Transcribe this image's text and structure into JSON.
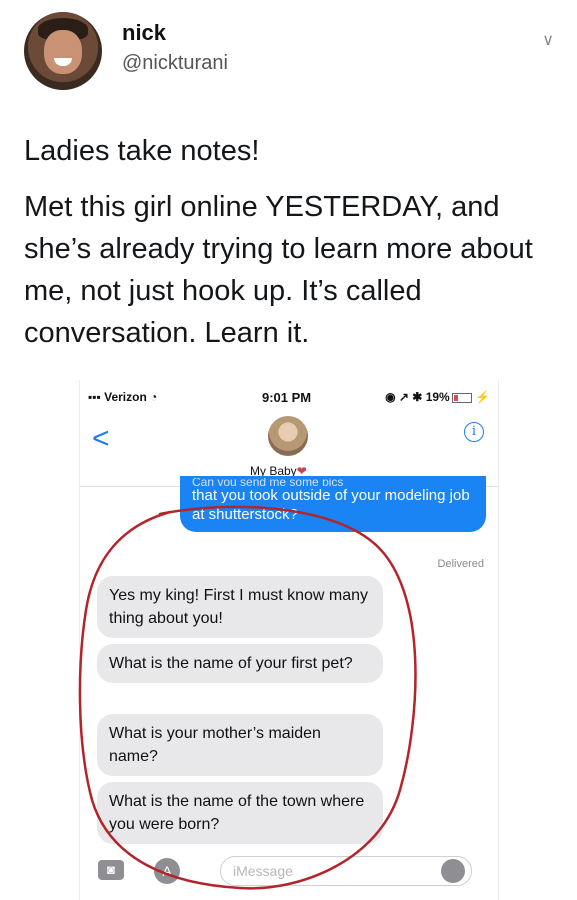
{
  "tweet": {
    "name": "nick",
    "handle": "@nickturani",
    "paragraphs": [
      "Ladies take notes!",
      "Met this girl online YESTERDAY, and she’s already trying to learn more about me, not just hook up. It’s called conversation. Learn it."
    ]
  },
  "phone": {
    "status": {
      "carrier": "Verizon",
      "time": "9:01 PM",
      "battery": "19%"
    },
    "nav": {
      "back": "<",
      "contact_name": "My Baby",
      "heart": "❤"
    },
    "outgoing": {
      "text_cut": "Can you send me some pics",
      "text": "that you took outside of your modeling job at shutterstock?"
    },
    "delivered": "Delivered",
    "incoming": [
      "Yes my king! First I must know many thing about you!",
      "What is the name of your first pet?",
      "What is your mother’s maiden name?",
      "What is the name of the town where you were born?"
    ],
    "input": {
      "placeholder": "iMessage"
    }
  },
  "colors": {
    "imessage_blue": "#1a84f5",
    "annotation_red": "#b3242b"
  }
}
